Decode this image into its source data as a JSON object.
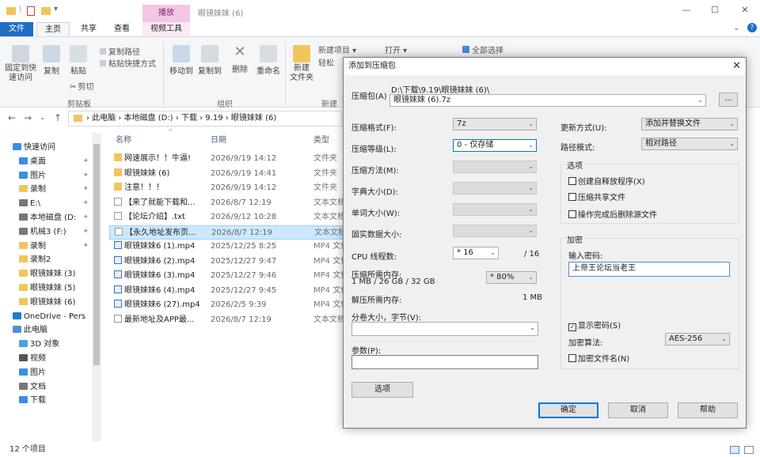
{
  "window": {
    "title": "眼镜妹妹 (6)",
    "context_tab": "播放",
    "min": "—",
    "max": "☐",
    "close": "✕"
  },
  "ribbon_tabs": [
    "文件",
    "主页",
    "共享",
    "查看",
    "视频工具"
  ],
  "ribbon": {
    "clipboard": {
      "pin": "固定到快\n速访问",
      "copy": "复制",
      "paste": "粘贴",
      "copy_path": "复制路径",
      "paste_shortcut": "粘贴快捷方式",
      "cut": "剪切",
      "group": "剪贴板"
    },
    "organize": {
      "move_to": "移动到",
      "copy_to": "复制到",
      "delete": "删除",
      "rename": "重命名",
      "group": "组织"
    },
    "new": {
      "new_folder": "新建\n文件夹",
      "new_item": "新建项目 ▾",
      "easy_access": "轻松",
      "group": "新建"
    },
    "open": {
      "open": "打开 ▾",
      "select_all": "全部选择"
    }
  },
  "address": {
    "parts": "› 此电脑 › 本地磁盘 (D:) › 下载 › 9.19 › 眼镜妹妹 (6)"
  },
  "nav": {
    "items": [
      {
        "label": "快速访问",
        "icon": "star-icon",
        "color": "#3a8ee6",
        "indent": 0,
        "pin": false
      },
      {
        "label": "桌面",
        "icon": "desktop-icon",
        "color": "#3a8ee6",
        "indent": 1,
        "pin": true
      },
      {
        "label": "图片",
        "icon": "pictures-icon",
        "color": "#3a8ee6",
        "indent": 1,
        "pin": true
      },
      {
        "label": "录制",
        "icon": "folder-icon",
        "color": "#f2c55c",
        "indent": 1,
        "pin": true
      },
      {
        "label": "E:\\",
        "icon": "drive-icon",
        "color": "#777777",
        "indent": 1,
        "pin": true
      },
      {
        "label": "本地磁盘 (D:",
        "icon": "drive-icon",
        "color": "#777777",
        "indent": 1,
        "pin": true
      },
      {
        "label": "机械3 (F:)",
        "icon": "drive-icon",
        "color": "#777777",
        "indent": 1,
        "pin": true
      },
      {
        "label": "录制",
        "icon": "folder-icon",
        "color": "#f2c55c",
        "indent": 1,
        "pin": true
      },
      {
        "label": "录制2",
        "icon": "folder-icon",
        "color": "#f2c55c",
        "indent": 1,
        "pin": false
      },
      {
        "label": "眼镜妹妹 (3)",
        "icon": "folder-icon",
        "color": "#f2c55c",
        "indent": 1,
        "pin": false
      },
      {
        "label": "眼镜妹妹 (5)",
        "icon": "folder-icon",
        "color": "#f2c55c",
        "indent": 1,
        "pin": false
      },
      {
        "label": "眼镜妹妹 (6)",
        "icon": "folder-icon",
        "color": "#f2c55c",
        "indent": 1,
        "pin": false
      },
      {
        "label": "OneDrive - Pers",
        "icon": "cloud-icon",
        "color": "#1e7bd6",
        "indent": 0,
        "pin": false
      },
      {
        "label": "此电脑",
        "icon": "computer-icon",
        "color": "#4a90d9",
        "indent": 0,
        "pin": false
      },
      {
        "label": "3D 对象",
        "icon": "cube-icon",
        "color": "#4aa3df",
        "indent": 1,
        "pin": false
      },
      {
        "label": "视频",
        "icon": "video-icon",
        "color": "#555555",
        "indent": 1,
        "pin": false
      },
      {
        "label": "图片",
        "icon": "pictures-icon",
        "color": "#3a8ee6",
        "indent": 1,
        "pin": false
      },
      {
        "label": "文档",
        "icon": "document-icon",
        "color": "#777777",
        "indent": 1,
        "pin": false
      },
      {
        "label": "下载",
        "icon": "download-icon",
        "color": "#3a8ee6",
        "indent": 1,
        "pin": false
      }
    ]
  },
  "columns": {
    "name": "名称",
    "date": "日期",
    "type": "类型"
  },
  "files": [
    {
      "name": "网速展示！！牛逼!",
      "date": "2026/9/19 14:12",
      "type": "文件夹",
      "icon": "folder-icon",
      "sel": false
    },
    {
      "name": "眼镜妹妹 (6)",
      "date": "2026/9/19 14:41",
      "type": "文件夹",
      "icon": "folder-icon",
      "sel": false
    },
    {
      "name": "注意！！！",
      "date": "2026/9/19 14:12",
      "type": "文件夹",
      "icon": "folder-icon",
      "sel": false
    },
    {
      "name": "【来了就能下载和...",
      "date": "2026/8/7 12:19",
      "type": "文本文档",
      "icon": "text-file-icon",
      "sel": false
    },
    {
      "name": "【论坛介绍】.txt",
      "date": "2026/9/12 10:28",
      "type": "文本文档",
      "icon": "text-file-icon",
      "sel": false
    },
    {
      "name": "【永久地址发布页...",
      "date": "2026/8/7 12:19",
      "type": "文本文档",
      "icon": "text-file-icon",
      "sel": true
    },
    {
      "name": "眼镜妹妹6 (1).mp4",
      "date": "2025/12/25 8:25",
      "type": "MP4 文件",
      "icon": "video-file-icon",
      "sel": false
    },
    {
      "name": "眼镜妹妹6 (2).mp4",
      "date": "2025/12/27 9:47",
      "type": "MP4 文件",
      "icon": "video-file-icon",
      "sel": false
    },
    {
      "name": "眼镜妹妹6 (3).mp4",
      "date": "2025/12/27 9:46",
      "type": "MP4 文件",
      "icon": "video-file-icon",
      "sel": false
    },
    {
      "name": "眼镜妹妹6 (4).mp4",
      "date": "2025/12/27 9:45",
      "type": "MP4 文件",
      "icon": "video-file-icon",
      "sel": false
    },
    {
      "name": "眼镜妹妹6 (27).mp4",
      "date": "2026/2/5 9:39",
      "type": "MP4 文件",
      "icon": "video-file-icon",
      "sel": false
    },
    {
      "name": "最新地址及APP最...",
      "date": "2026/8/7 12:19",
      "type": "文本文档",
      "icon": "text-file-icon",
      "sel": false
    }
  ],
  "status": {
    "count": "12 个项目"
  },
  "dialog": {
    "title": "添加到压缩包",
    "close": "✕",
    "archive_label": "压缩包(A)",
    "archive_dir": "D:\\下载\\9.19\\眼镜妹妹 (6)\\",
    "archive_name": "眼镜妹妹 (6).7z",
    "browse": "...",
    "format_label": "压缩格式(F):",
    "format": "7z",
    "level_label": "压缩等级(L):",
    "level": "0 - 仅存储",
    "method_label": "压缩方法(M):",
    "dict_label": "字典大小(D):",
    "word_label": "单词大小(W):",
    "solid_label": "固实数据大小:",
    "cpu_label": "CPU 线程数:",
    "cpu_value": "* 16",
    "cpu_max": "/ 16",
    "mem_label": "压缩所需内存:",
    "mem_detail": "1 MB / 26 GB / 32 GB",
    "mem_pct": "* 80%",
    "decomp_label": "解压所需内存:",
    "decomp_value": "1 MB",
    "split_label": "分卷大小，字节(V):",
    "params_label": "参数(P):",
    "options_btn": "选项",
    "update_label": "更新方式(U):",
    "update_value": "添加并替换文件",
    "path_label": "路径模式:",
    "path_value": "相对路径",
    "options_group": "选项",
    "opt_sfx": "创建自释放程序(X)",
    "opt_shared": "压缩共享文件",
    "opt_delete": "操作完成后删除源文件",
    "enc_group": "加密",
    "pwd_label": "输入密码:",
    "pwd_value": "上帝王论坛当老王",
    "show_pwd": "显示密码(S)",
    "enc_method_label": "加密算法:",
    "enc_method": "AES-256",
    "enc_names": "加密文件名(N)",
    "ok": "确定",
    "cancel": "取消",
    "help": "帮助"
  }
}
